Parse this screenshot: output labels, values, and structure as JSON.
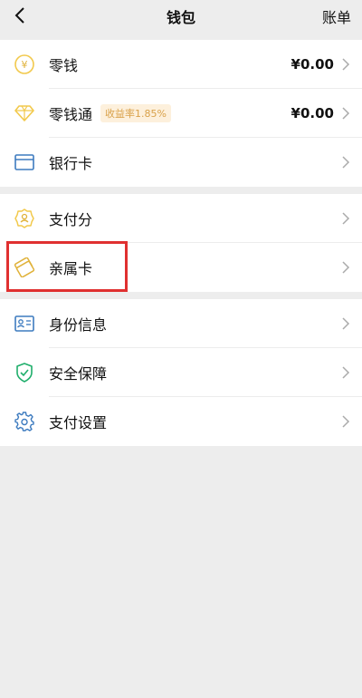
{
  "navbar": {
    "title": "钱包",
    "right_label": "账单"
  },
  "groups": [
    {
      "items": [
        {
          "label": "零钱",
          "value": "¥0.00",
          "icon": "coin-icon"
        },
        {
          "label": "零钱通",
          "badge": "收益率1.85%",
          "value": "¥0.00",
          "icon": "diamond-icon"
        },
        {
          "label": "银行卡",
          "icon": "bank-card-icon"
        }
      ]
    },
    {
      "items": [
        {
          "label": "支付分",
          "icon": "pay-score-icon"
        },
        {
          "label": "亲属卡",
          "icon": "family-card-icon"
        }
      ]
    },
    {
      "items": [
        {
          "label": "身份信息",
          "icon": "id-card-icon"
        },
        {
          "label": "安全保障",
          "icon": "shield-icon"
        },
        {
          "label": "支付设置",
          "icon": "gear-icon"
        }
      ]
    }
  ],
  "colors": {
    "coin": "#f2c94c",
    "diamond": "#f2c94c",
    "blue": "#3d7bbf",
    "green": "#1fae6b",
    "highlight": "#e03030"
  }
}
